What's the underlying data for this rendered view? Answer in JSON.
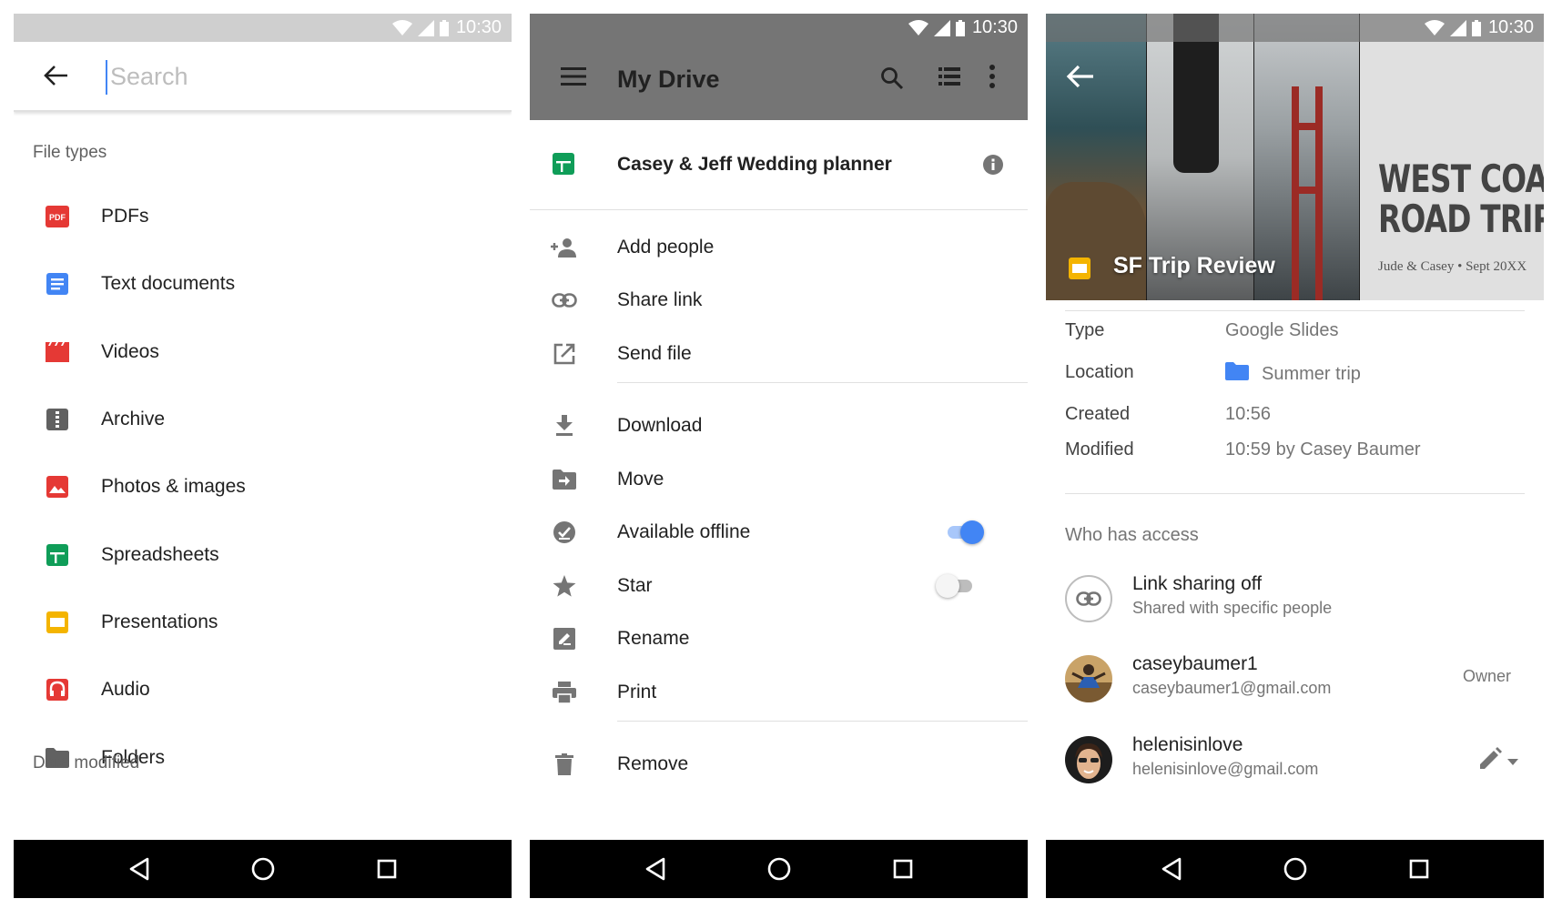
{
  "status_bar": {
    "time": "10:30"
  },
  "search_screen": {
    "search_placeholder": "Search",
    "section_file_types": "File types",
    "file_types": [
      {
        "label": "PDFs",
        "icon": "pdf-icon"
      },
      {
        "label": "Text documents",
        "icon": "text-document-icon"
      },
      {
        "label": "Videos",
        "icon": "video-icon"
      },
      {
        "label": "Archive",
        "icon": "archive-icon"
      },
      {
        "label": "Photos & images",
        "icon": "image-icon"
      },
      {
        "label": "Spreadsheets",
        "icon": "spreadsheet-icon"
      },
      {
        "label": "Presentations",
        "icon": "presentation-icon"
      },
      {
        "label": "Audio",
        "icon": "audio-icon"
      },
      {
        "label": "Folders",
        "icon": "folder-icon"
      }
    ],
    "section_date_modified": "Date modified",
    "pdf_badge": "PDF"
  },
  "drive_screen": {
    "title": "My Drive",
    "file_name": "Casey & Jeff Wedding planner",
    "menu_items": [
      {
        "label": "Add people",
        "icon": "add-person-icon"
      },
      {
        "label": "Share link",
        "icon": "link-icon"
      },
      {
        "label": "Send file",
        "icon": "open-external-icon"
      },
      {
        "label": "Download",
        "icon": "download-icon"
      },
      {
        "label": "Move",
        "icon": "move-folder-icon"
      },
      {
        "label": "Available offline",
        "icon": "offline-check-icon",
        "toggle": true
      },
      {
        "label": "Star",
        "icon": "star-icon",
        "toggle": false
      },
      {
        "label": "Rename",
        "icon": "rename-icon"
      },
      {
        "label": "Print",
        "icon": "print-icon"
      },
      {
        "label": "Remove",
        "icon": "trash-icon"
      }
    ]
  },
  "details_screen": {
    "file_title": "SF Trip Review",
    "hero_headline_line1": "WEST COAST",
    "hero_headline_line2": "ROAD TRIP",
    "hero_subline": "Jude & Casey • Sept 20XX",
    "details": [
      {
        "key": "Type",
        "value": "Google Slides"
      },
      {
        "key": "Location",
        "value": "Summer trip"
      },
      {
        "key": "Created",
        "value": "10:56"
      },
      {
        "key": "Modified",
        "value": "10:59 by Casey Baumer"
      }
    ],
    "who_has_access": "Who has access",
    "link_sharing": {
      "title": "Link sharing off",
      "subtitle": "Shared with specific people"
    },
    "people": [
      {
        "name": "caseybaumer1",
        "email": "caseybaumer1@gmail.com",
        "role": "Owner"
      },
      {
        "name": "helenisinlove",
        "email": "helenisinlove@gmail.com",
        "role": ""
      }
    ]
  },
  "colors": {
    "accent_blue": "#4285f4",
    "pdf_red": "#e53935",
    "docs_blue": "#4285f4",
    "sheets_green": "#0f9d58",
    "slides_yellow": "#f4b400",
    "archive_gray": "#616161",
    "folder_gray": "#616161"
  }
}
